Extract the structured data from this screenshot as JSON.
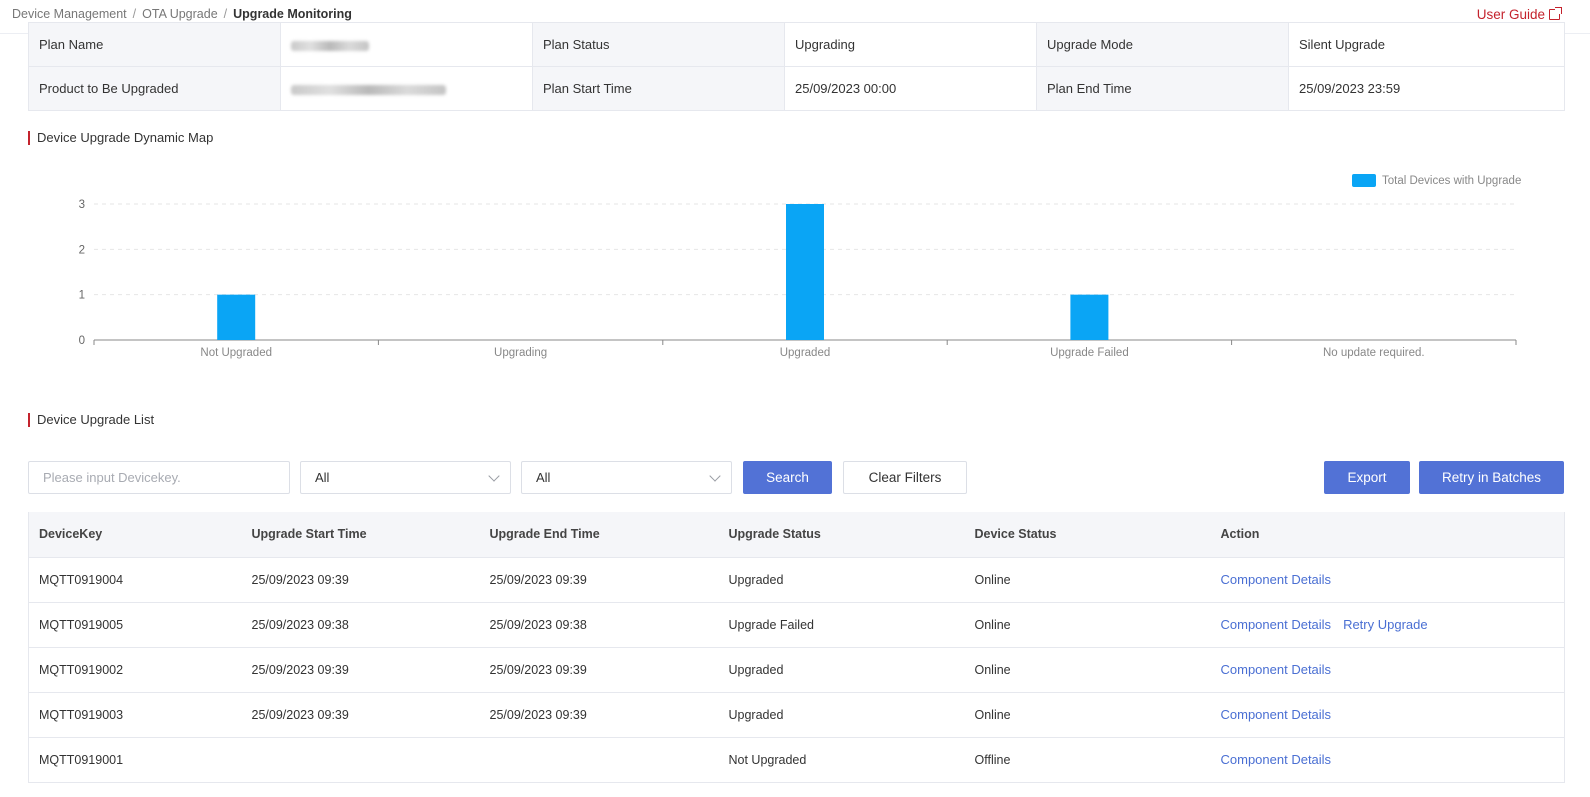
{
  "breadcrumb": {
    "items": [
      "Device Management",
      "OTA Upgrade",
      "Upgrade Monitoring"
    ],
    "separator": "/"
  },
  "user_guide_label": "User Guide",
  "plan": {
    "plan_name_label": "Plan Name",
    "plan_status_label": "Plan Status",
    "plan_status_value": "Upgrading",
    "upgrade_mode_label": "Upgrade Mode",
    "upgrade_mode_value": "Silent Upgrade",
    "product_label": "Product to Be Upgraded",
    "start_time_label": "Plan Start Time",
    "start_time_value": "25/09/2023 00:00",
    "end_time_label": "Plan End Time",
    "end_time_value": "25/09/2023 23:59"
  },
  "map_section_title": "Device Upgrade Dynamic Map",
  "list_section_title": "Device Upgrade List",
  "chart_data": {
    "type": "bar",
    "categories": [
      "Not Upgraded",
      "Upgrading",
      "Upgraded",
      "Upgrade Failed",
      "No update required."
    ],
    "series": [
      {
        "name": "Total Devices with Upgrade",
        "values": [
          1,
          0,
          3,
          1,
          0
        ]
      }
    ],
    "ylim": [
      0,
      3
    ],
    "yticks": [
      0,
      1,
      2,
      3
    ],
    "grid": true,
    "legend": "top-right",
    "color": "#0aa5f5"
  },
  "filters": {
    "devicekey_placeholder": "Please input Devicekey.",
    "upgrade_status_value": "All",
    "device_status_value": "All",
    "search_label": "Search",
    "clear_label": "Clear Filters",
    "export_label": "Export",
    "retry_batches_label": "Retry in Batches"
  },
  "table": {
    "columns": [
      "DeviceKey",
      "Upgrade Start Time",
      "Upgrade End Time",
      "Upgrade Status",
      "Device Status",
      "Action"
    ],
    "rows": [
      {
        "key": "MQTT0919004",
        "start": "25/09/2023 09:39",
        "end": "25/09/2023 09:39",
        "upgrade_status": "Upgraded",
        "device_status": "Online",
        "actions": [
          "Component Details"
        ]
      },
      {
        "key": "MQTT0919005",
        "start": "25/09/2023 09:38",
        "end": "25/09/2023 09:38",
        "upgrade_status": "Upgrade Failed",
        "device_status": "Online",
        "actions": [
          "Component Details",
          "Retry Upgrade"
        ]
      },
      {
        "key": "MQTT0919002",
        "start": "25/09/2023 09:39",
        "end": "25/09/2023 09:39",
        "upgrade_status": "Upgraded",
        "device_status": "Online",
        "actions": [
          "Component Details"
        ]
      },
      {
        "key": "MQTT0919003",
        "start": "25/09/2023 09:39",
        "end": "25/09/2023 09:39",
        "upgrade_status": "Upgraded",
        "device_status": "Online",
        "actions": [
          "Component Details"
        ]
      },
      {
        "key": "MQTT0919001",
        "start": "",
        "end": "",
        "upgrade_status": "Not Upgraded",
        "device_status": "Offline",
        "actions": [
          "Component Details"
        ]
      }
    ]
  }
}
